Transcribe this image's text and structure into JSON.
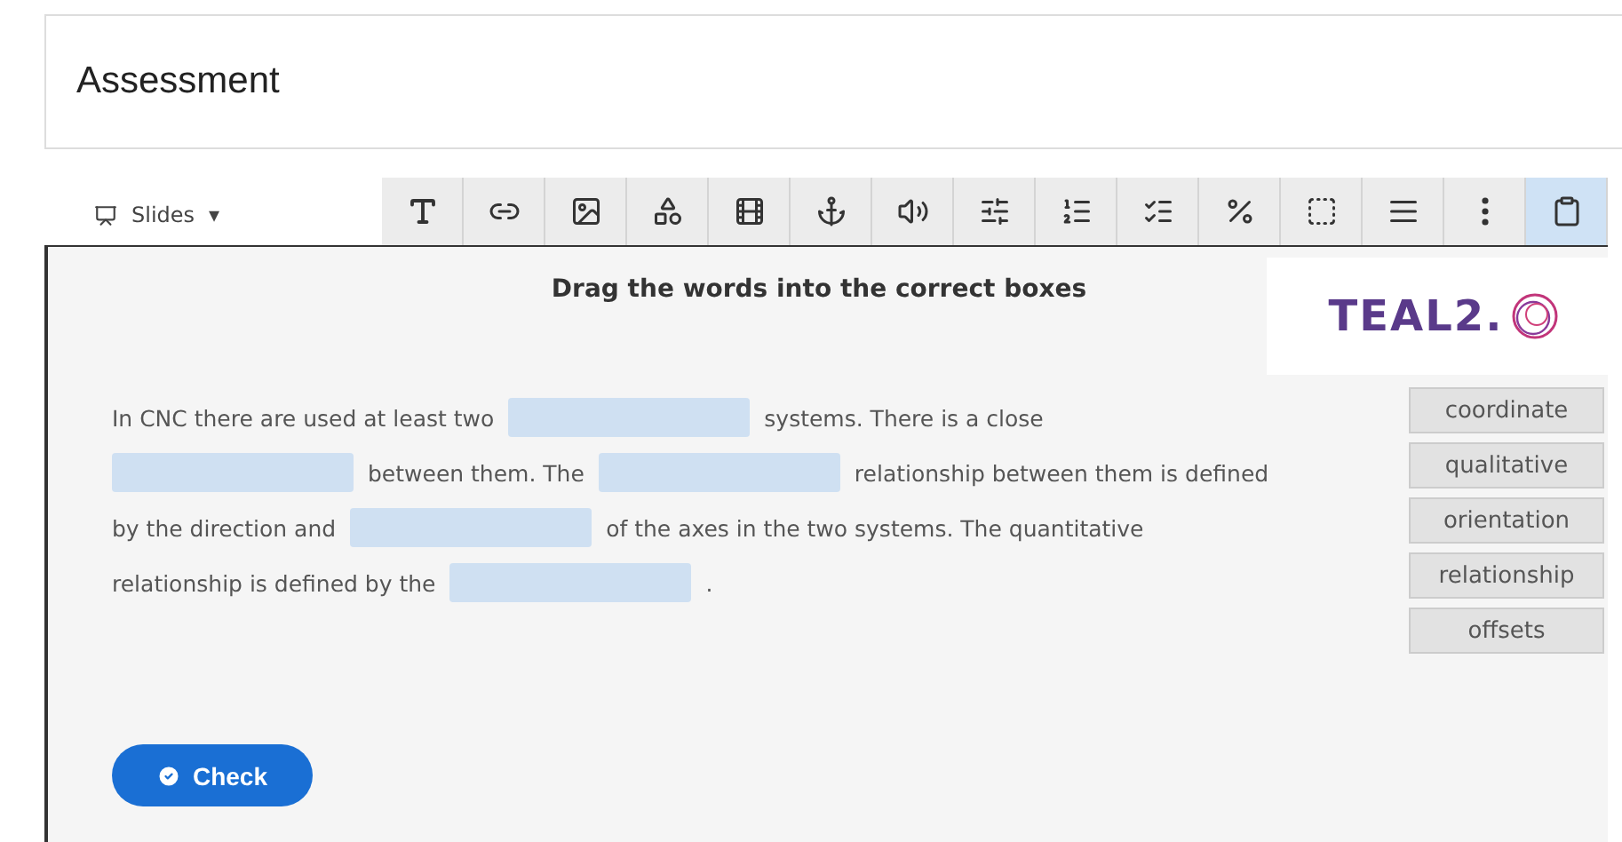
{
  "title_field": {
    "value": "Assessment"
  },
  "slides_menu": {
    "label": "Slides",
    "caret": "▾"
  },
  "tools": [
    {
      "selected": false
    },
    {
      "selected": false
    },
    {
      "selected": false
    },
    {
      "selected": false
    },
    {
      "selected": false
    },
    {
      "selected": false
    },
    {
      "selected": false
    },
    {
      "selected": false
    },
    {
      "selected": false
    },
    {
      "selected": false
    },
    {
      "selected": false
    },
    {
      "selected": false
    },
    {
      "selected": false
    },
    {
      "selected": false
    },
    {
      "selected": true
    }
  ],
  "exercise": {
    "heading": "Drag the words into the correct boxes",
    "logo": {
      "text": "TEAL2."
    },
    "lines": [
      [
        {
          "kind": "text",
          "text": "In CNC there are used at least two"
        },
        {
          "kind": "blank"
        },
        {
          "kind": "text",
          "text": "systems. There is a close"
        }
      ],
      [
        {
          "kind": "blank"
        },
        {
          "kind": "text",
          "text": "between them. The"
        },
        {
          "kind": "blank"
        },
        {
          "kind": "text",
          "text": "relationship between them is defined"
        }
      ],
      [
        {
          "kind": "text",
          "text": "by the direction and"
        },
        {
          "kind": "blank"
        },
        {
          "kind": "text",
          "text": "of the axes in the two systems. The quantitative"
        }
      ],
      [
        {
          "kind": "text",
          "text": "relationship is defined by the"
        },
        {
          "kind": "blank"
        },
        {
          "kind": "text",
          "text": "."
        }
      ]
    ],
    "words": [
      "coordinate",
      "qualitative",
      "orientation",
      "relationship",
      "offsets"
    ],
    "check_button": {
      "label": "Check"
    }
  }
}
